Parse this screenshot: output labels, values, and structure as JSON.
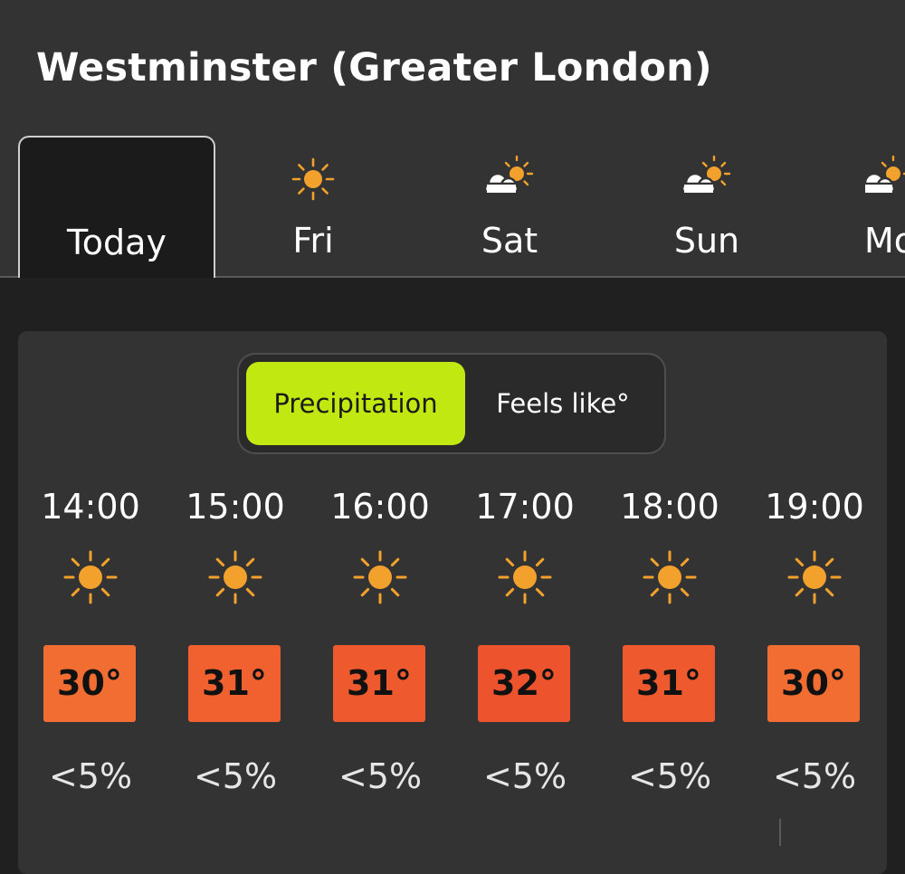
{
  "location": {
    "title": "Westminster (Greater London)"
  },
  "days": [
    {
      "label": "Today",
      "icon": "none",
      "active": true
    },
    {
      "label": "Fri",
      "icon": "sun-icon",
      "active": false
    },
    {
      "label": "Sat",
      "icon": "sun-behind-cloud-icon",
      "active": false
    },
    {
      "label": "Sun",
      "icon": "sun-behind-cloud-icon",
      "active": false
    },
    {
      "label": "Mo",
      "icon": "sun-behind-cloud-icon",
      "active": false
    }
  ],
  "toggle": {
    "precipitation_label": "Precipitation",
    "feels_like_label": "Feels like°",
    "selected": "Precipitation"
  },
  "hourly": [
    {
      "time": "14:00",
      "icon": "sun-icon",
      "temp": "30°",
      "temp_color": "#f26d32",
      "precip": "<5%"
    },
    {
      "time": "15:00",
      "icon": "sun-icon",
      "temp": "31°",
      "temp_color": "#f0612f",
      "precip": "<5%"
    },
    {
      "time": "16:00",
      "icon": "sun-icon",
      "temp": "31°",
      "temp_color": "#ee5a2e",
      "precip": "<5%"
    },
    {
      "time": "17:00",
      "icon": "sun-icon",
      "temp": "32°",
      "temp_color": "#ed532c",
      "precip": "<5%"
    },
    {
      "time": "18:00",
      "icon": "sun-icon",
      "temp": "31°",
      "temp_color": "#ee5a2e",
      "precip": "<5%"
    },
    {
      "time": "19:00",
      "icon": "sun-icon",
      "temp": "30°",
      "temp_color": "#f26d32",
      "precip": "<5%"
    }
  ],
  "colors": {
    "header_bg": "#333333",
    "page_bg": "#202020",
    "accent": "#c2e812",
    "sun": "#f2a12c"
  }
}
